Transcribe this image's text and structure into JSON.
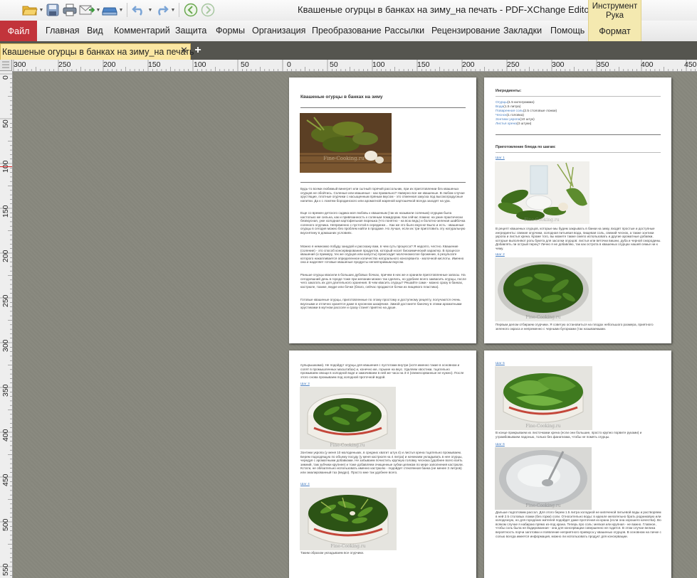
{
  "window": {
    "title": "Квашеные огурцы в банках на зиму_на печать - PDF-XChange Editor",
    "tool_group": "Инструмент Рука"
  },
  "quick_access": [
    "open-folder-icon",
    "save-icon",
    "print-icon",
    "email-icon",
    "scan-icon",
    "undo-icon",
    "redo-icon",
    "back-icon",
    "forward-icon"
  ],
  "ribbon": {
    "file": "Файл",
    "tabs": [
      "Главная",
      "Вид",
      "Комментарий",
      "Защита",
      "Формы",
      "Организация",
      "Преобразование",
      "Рассылки",
      "Рецензирование",
      "Закладки",
      "Помощь"
    ],
    "format": "Формат"
  },
  "document_tab": {
    "label": "Квашеные огурцы в банках на зиму_на печать",
    "close": "✕",
    "new": "+"
  },
  "ruler": {
    "h_labels": [
      "300",
      "250",
      "200",
      "150",
      "100",
      "50",
      "0",
      "50",
      "100",
      "150",
      "200",
      "250",
      "300",
      "350",
      "400",
      "450"
    ],
    "v_labels": [
      "0",
      "50",
      "100",
      "150",
      "200",
      "250",
      "300",
      "350",
      "400",
      "450",
      "500",
      "550"
    ]
  },
  "page1": {
    "title": "Квашеные огурцы в банках на зиму",
    "p1": "Будь-то всеми любимый винегрет или сытный горячий рассольник, при их приготовлении без квашеных огурцов не обойтись. Соленые или квашеные - как правильно? Наверно все же квашеные. В любом случае хрустящие, плотные огурчики с насыщенным пряным вкусом - это отменная закуска под высокоградусные напитки. Да к с ломтем бородинского или ароматной жареной картошечкой всегда заходят на ура.",
    "p2": "Еще со времен детского садика моя любовь к квашеным (так их называли соленым) огурцам была настолько же сильна, как и привязанность к соленым помидорам. Как сейчас помню: на ужин практически безвкусная, уже холодная картофельная пюрешка (что понятно - на всю ведь) и болотно-зеленая шайбочка соленого огурчика. Непременно с пустотой в серединке… Как же это было вкусно! Было и есть - квашеные огурцы в сегодня можно без проблем найти в продаже. Но лучше, если их три приготовить эту натуральную вкуснятину в домашних условиях.",
    "p3": "Можно я немножко побуду занудой и расскажу вам, в чем суть процесса? Я недолго, честно. Квашение (соление) - это способ консервирования продуктов, который носит биохимический характер. В процессе квашения (к примеру, тех же огурцов или капусты) происходит молочнокислое брожение, в результате которого накапливается определенное количество натурального консерванта - молочной кислоты. Именно она и наделяет готовые квашеные продукты неповторимым вкусом.",
    "p4": "Раньше огурцы квасили в больших дубовых бочках, причем в них же и хранили приготовленные запасы. На сегодняшний день в городе тоже при желании можно так сделать, но удобнее всего заквасить огурцы, после чего закатать их для длительного хранения. В чем квасить огурцы? Решайте сами - можно сразу в банках, кастрюле, тазике, ведре или бочке (благо, сейчас продаются бочки из пищевого пластика).",
    "p5": "Готовые квашеные огурцы, приготовленные по этому простому и доступному рецепту, получаются очень вкусными и отлично хранятся даже в кухонном шкафчике. Зимой достанете баночку в этими ароматными хрустиками в мутном рассоле и сразу станет приятно на душе."
  },
  "page2": {
    "ingredients_title": "Ингредиенты:",
    "ingredients": [
      {
        "name": "Огурцы",
        "qty": "(1.5 килограмма)"
      },
      {
        "name": "Вода",
        "qty": "(1.5 литра)"
      },
      {
        "name": "Поваренная соль",
        "qty": "(2.5 столовые ложки)"
      },
      {
        "name": "Чеснок",
        "qty": "(1 головка)"
      },
      {
        "name": "Зонтики укропа",
        "qty": "(10 штук)"
      },
      {
        "name": "Листья хрена",
        "qty": "(3 штуки)"
      }
    ],
    "steps_title": "Приготовление блюда по шагам:",
    "step1": "Шаг 1",
    "step1_text": "В рецепт квашеных огурцов, которые мы будем закрывать в банки на зиму, входят простые и доступные ингредиенты: свежие огурчики, холодная питьевая вода, пищевая соль, свежий чеснок, а также зонтики укропа и листья хрена. Кроме того, вы можете также смело использовать и другие ароматные добавки, которые выполняют роль букета для засолки огурцов: листья или веточки вишни, дуба и черной смородины. Добавлять ли острый перец? Лично я не добавляю, так как острота в квашеных огурцах нашей семье ни к чему.",
    "step2": "Шаг 2",
    "step2_text": "Первым делом отбираем огурчики. Я советую остановиться на плодах небольшого размера, приятного зеленого окраса и непременно с черными бугорками (так называемыми."
  },
  "page3": {
    "text_top": "пупырышками). Не подойдут огурцы для квашения с пустотами внутри (хотя именно такие в основном и солят в промышленных масштабах) и, конечно же, горькие на вкус. Удаляем хвостики, тщательно промываем овощи в холодной воде и замачиваем в ней же часа на 3-4 (свежесорванные не нужно). После этого снова промываем под холодной проточной водой.",
    "step3": "Шаг 3",
    "step3_text": "Зонтики укропа (у меня 10 молоденьких, в средних хватит штук 4) и листья хрена тщательно промываем. Берем подходящую по объему посуду (у меня кастрюля на 4 литра) и начинаем укладывать в нее огурцы, чередуя с ароматными добавками. Не забываем почистить крупную головку чеснока (удобнее всего взять зимний, там зубчики крупнее) и тоже добавляем очищенные зубки целиком по мере заполнения кастрюли. Кстати, не обязательно использовать именно кастрюлю - подойдет стеклянная банка (не менее 3 литров) или эмалированный таз (ведро). Просто мне так удобнее всего.",
    "step4": "Шаг 4",
    "step4_text": "Таким образом укладываем все огурчики."
  },
  "page4": {
    "step5": "Шаг 5",
    "step5_text": "В конце прикрываем их листочками хрена (если они большие, просто крупно порвите руками) и утрамбовываем ладонью, только без фанатизма, чтобы не помять огурцы.",
    "step6": "Шаг 6",
    "step6_text": "Дальше подготовим рассол. Для этого берем 1.5 литра холодной не кипяченой питьевой воды и растворяем в ней 2.5 столовых ложки (без горки) соли. Относительно воды: в идеале желательно брать родниковую или колодезную, но для городских жителей подойдет даже проточная из крана (если она хорошего качества). Во всяком случае я набираю прямо из-под крана. Теперь про соль: мелкая или крупная - не важно. Главное, чтобы соль была не йодированная - она для консервации совершенно не годится. В этом случае велика вероятность порчи заготовки и появление неприятного привкуса у квашеных огурцов. В основном на пачке с солью всегда имеется информация, можно ли использовать продукт для консервации."
  },
  "photo_watermark": "Fine-Cooking.ru",
  "colors": {
    "file_tab": "#c2343b",
    "tool_group": "#f4e9b0",
    "doc_tab": "#fbe7a3",
    "link": "#4a7fc1"
  }
}
